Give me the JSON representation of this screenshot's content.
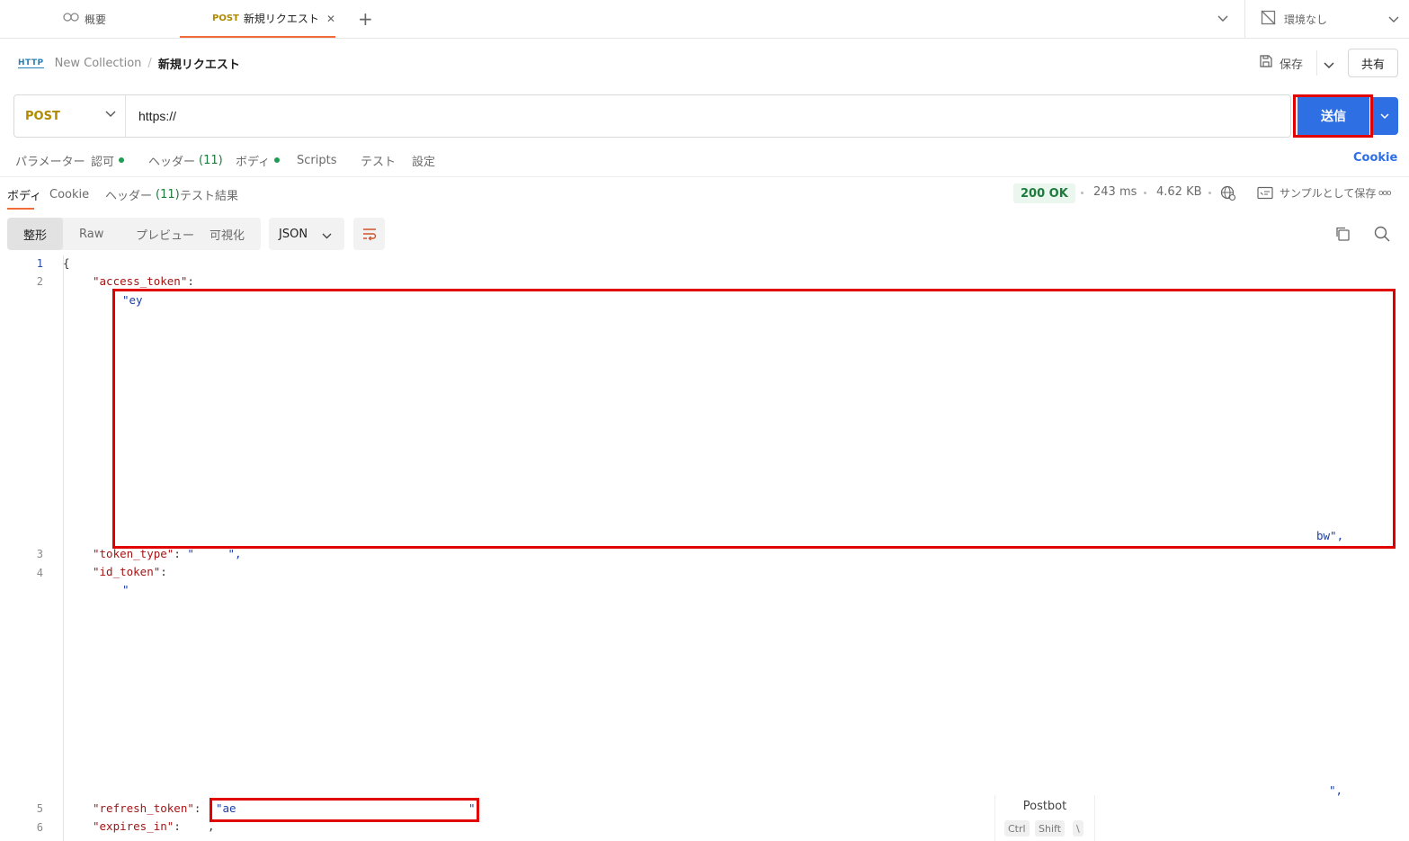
{
  "tabs": {
    "overview_label": "概要",
    "active_method": "POST",
    "active_label": "新規リクエスト",
    "close_glyph": "✕",
    "add_glyph": "+",
    "environment": "環境なし"
  },
  "breadcrumb": {
    "http_badge": "HTTP",
    "collection": "New Collection",
    "separator": "/",
    "current": "新規リクエスト"
  },
  "header_actions": {
    "save_label": "保存",
    "share_label": "共有"
  },
  "request": {
    "method": "POST",
    "url": "https://",
    "send_label": "送信"
  },
  "request_tabs": {
    "params": "パラメーター",
    "auth": "認可",
    "headers": "ヘッダー",
    "headers_count": "(11)",
    "body": "ボディ",
    "scripts": "Scripts",
    "tests": "テスト",
    "settings": "設定",
    "cookie": "Cookie"
  },
  "response_tabs": {
    "body": "ボディ",
    "cookie": "Cookie",
    "headers": "ヘッダー",
    "headers_count": "(11)",
    "test_results": "テスト結果"
  },
  "response_meta": {
    "status": "200 OK",
    "time": "243 ms",
    "size": "4.62 KB",
    "save_sample": "サンプルとして保存",
    "more": "ooo"
  },
  "format_toolbar": {
    "pretty": "整形",
    "raw": "Raw",
    "preview": "プレビュー",
    "visualize": "可視化",
    "format": "JSON"
  },
  "code": {
    "line_numbers": [
      "1",
      "2",
      "3",
      "4",
      "5",
      "6"
    ],
    "open_brace": "{",
    "access_token_key": "\"access_token\"",
    "access_token_start": "\"ey",
    "access_token_end": "bw\",",
    "token_type_key": "\"token_type\"",
    "token_type_val": "\"     \",",
    "id_token_key": "\"id_token\"",
    "id_token_start": "\"",
    "id_token_end": "\",",
    "refresh_token_key": "\"refresh_token\"",
    "refresh_token_start": "\"ae",
    "refresh_token_end": "\"",
    "expires_in_key": "\"expires_in\"",
    "expires_in_val": ","
  },
  "postbot": {
    "title": "Postbot",
    "key1": "Ctrl",
    "key2": "Shift",
    "key3": "\\"
  },
  "colors": {
    "accent": "#f26b3a",
    "send_button": "#2f6fe4",
    "highlight_box": "#e00000",
    "status_ok": "#1f7a3d"
  },
  "icons": [
    "overview-icon",
    "http-icon",
    "save-icon",
    "chevron-down-icon",
    "environment-icon",
    "wrap-icon",
    "copy-icon",
    "search-icon",
    "globe-icon",
    "sample-icon"
  ]
}
